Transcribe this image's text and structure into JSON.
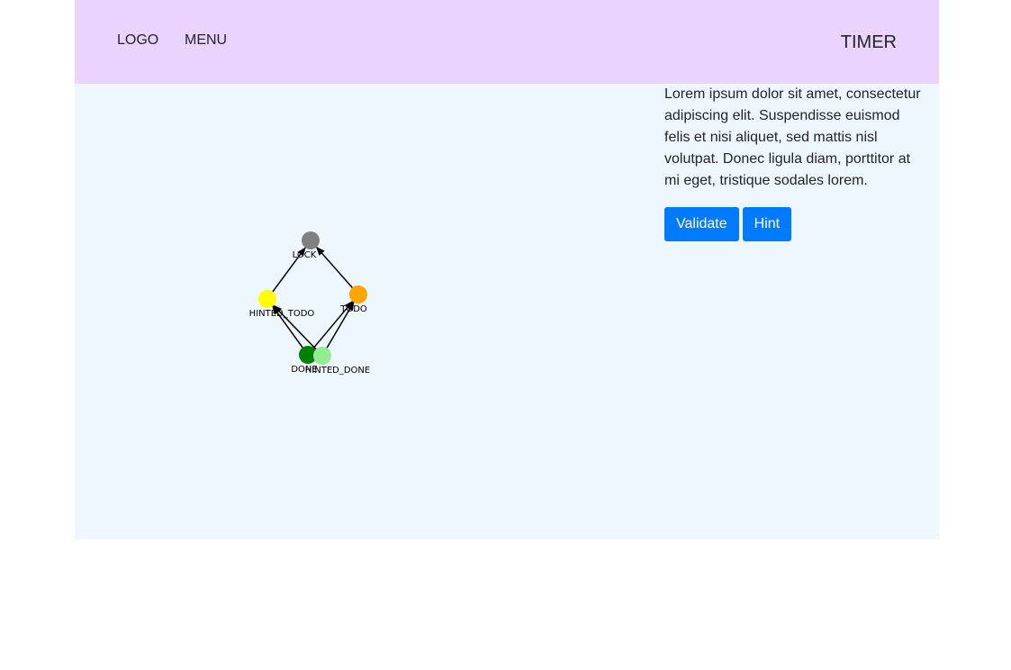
{
  "navbar": {
    "logo": "LOGO",
    "menu": "MENU",
    "timer": "TIMER",
    "background": "#ead4fe"
  },
  "main": {
    "background": "#eef6fe"
  },
  "graph": {
    "nodes": [
      {
        "id": "LOCK",
        "label": "LOCK",
        "color": "#808080"
      },
      {
        "id": "HINTED_TODO",
        "label": "HINTED_TODO",
        "color": "#ffff00"
      },
      {
        "id": "TODO",
        "label": "TODO",
        "color": "#ffa500"
      },
      {
        "id": "DONE",
        "label": "DONE",
        "color": "#008000"
      },
      {
        "id": "HINTED_DONE",
        "label": "HINTED_DONE",
        "color": "#90ee90"
      }
    ],
    "edges": [
      {
        "from": "HINTED_TODO",
        "to": "LOCK"
      },
      {
        "from": "TODO",
        "to": "LOCK"
      },
      {
        "from": "DONE",
        "to": "HINTED_TODO"
      },
      {
        "from": "DONE",
        "to": "TODO"
      },
      {
        "from": "HINTED_DONE",
        "to": "HINTED_TODO"
      },
      {
        "from": "HINTED_DONE",
        "to": "TODO"
      }
    ]
  },
  "side": {
    "description": "Lorem ipsum dolor sit amet, consectetur adipiscing elit. Suspendisse euismod felis et nisi aliquet, sed mattis nisl volutpat. Donec ligula diam, porttitor at mi eget, tristique sodales lorem.",
    "validate_label": "Validate",
    "hint_label": "Hint",
    "button_color": "#007bff"
  }
}
